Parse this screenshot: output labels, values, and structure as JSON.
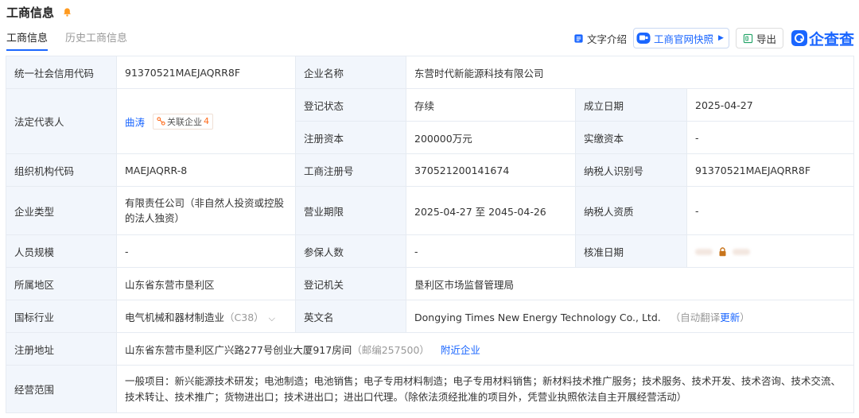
{
  "header": {
    "title": "工商信息"
  },
  "tabs": [
    {
      "label": "工商信息",
      "active": true
    },
    {
      "label": "历史工商信息",
      "active": false
    }
  ],
  "actions": {
    "text_intro": "文字介绍",
    "snapshot": "工商官网快照",
    "export": "导出",
    "logo": "企查查"
  },
  "rows": {
    "credit_code": {
      "label": "统一社会信用代码",
      "value": "91370521MAEJAQRR8F"
    },
    "company_name": {
      "label": "企业名称",
      "value": "东营时代新能源科技有限公司"
    },
    "legal_rep": {
      "label": "法定代表人",
      "name": "曲涛",
      "related_label": "关联企业",
      "related_count": "4"
    },
    "reg_status": {
      "label": "登记状态",
      "value": "存续"
    },
    "found_date": {
      "label": "成立日期",
      "value": "2025-04-27"
    },
    "reg_capital": {
      "label": "注册资本",
      "value": "200000万元"
    },
    "paid_capital": {
      "label": "实缴资本",
      "value": "-"
    },
    "org_code": {
      "label": "组织机构代码",
      "value": "MAEJAQRR-8"
    },
    "reg_no": {
      "label": "工商注册号",
      "value": "370521200141674"
    },
    "taxpayer_id": {
      "label": "纳税人识别号",
      "value": "91370521MAEJAQRR8F"
    },
    "company_type": {
      "label": "企业类型",
      "value": "有限责任公司（非自然人投资或控股的法人独资）"
    },
    "biz_term": {
      "label": "营业期限",
      "value": "2025-04-27 至 2045-04-26"
    },
    "taxpayer_qual": {
      "label": "纳税人资质",
      "value": "-"
    },
    "staff_size": {
      "label": "人员规模",
      "value": "-"
    },
    "insured": {
      "label": "参保人数",
      "value": "-"
    },
    "approve_date": {
      "label": "核准日期"
    },
    "region": {
      "label": "所属地区",
      "value": "山东省东营市垦利区"
    },
    "reg_authority": {
      "label": "登记机关",
      "value": "垦利区市场监督管理局"
    },
    "industry": {
      "label": "国标行业",
      "value": "电气机械和器材制造业",
      "code": "（C38）"
    },
    "english_name": {
      "label": "英文名",
      "value": "Dongying Times New Energy Technology Co., Ltd.",
      "note": "（自动翻译",
      "update": "更新",
      "note_end": "）"
    },
    "address": {
      "label": "注册地址",
      "value": "山东省东营市垦利区广兴路277号创业大厦917房间",
      "postcode": "（邮编257500）",
      "nearby": "附近企业"
    },
    "scope": {
      "label": "经营范围",
      "value": "一般项目：新兴能源技术研发；电池制造；电池销售；电子专用材料制造；电子专用材料销售；新材料技术推广服务；技术服务、技术开发、技术咨询、技术交流、技术转让、技术推广；货物进出口；技术进出口；进出口代理。（除依法须经批准的项目外，凭营业执照依法自主开展经营活动）"
    }
  },
  "colors": {
    "accent": "#1a66ff",
    "label_bg": "#f2f6fc",
    "border": "#e6ebf2",
    "orange": "#ff6a1a"
  }
}
